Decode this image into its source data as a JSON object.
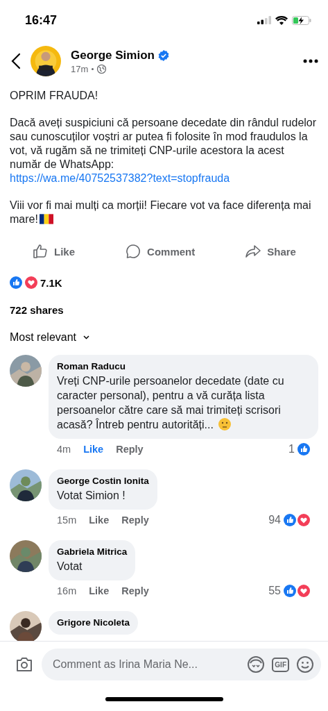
{
  "status_bar": {
    "time": "16:47"
  },
  "post": {
    "author": "George Simion",
    "verified": true,
    "time": "17m",
    "paragraphs": [
      {
        "text": "OPRIM FRAUDA!"
      },
      {
        "text": "Dacă aveți suspiciuni că persoane decedate din rândul rudelor sau cunoscuților voștri ar putea fi folosite în mod fraudulos la vot, vă rugăm să ne trimiteți CNP-urile acestora la acest număr de WhatsApp:",
        "link": "https://wa.me/40752537382?text=stopfrauda"
      },
      {
        "text": "Viii vor fi mai mulți ca morții! Fiecare vot va face diferența mai mare!",
        "flag": true
      }
    ]
  },
  "actions": [
    {
      "label": "Like",
      "kind": "like"
    },
    {
      "label": "Comment",
      "kind": "comment"
    },
    {
      "label": "Share",
      "kind": "share"
    }
  ],
  "reactions": {
    "types": [
      {
        "kind": "like"
      },
      {
        "kind": "love"
      }
    ],
    "count": "7.1K"
  },
  "shares": "722 shares",
  "sort": "Most relevant",
  "comments": [
    {
      "author": "Roman Raducu",
      "text": "Vreți CNP-urile persoanelor decedate (date cu caracter personal), pentru a vă curăța lista persoanelor către care să mai trimiteți scrisori acasă? Întreb pentru autorități...",
      "emoji": true,
      "time": "4m",
      "like": "Like",
      "liked": true,
      "reply": "Reply",
      "count": "1",
      "reactions": [
        {
          "kind": "like"
        }
      ]
    },
    {
      "author": "George Costin Ionita",
      "text": "Votat Simion !",
      "time": "15m",
      "like": "Like",
      "liked": false,
      "reply": "Reply",
      "count": "94",
      "reactions": [
        {
          "kind": "like"
        },
        {
          "kind": "love"
        }
      ]
    },
    {
      "author": "Gabriela Mitrica",
      "text": "Votat",
      "time": "16m",
      "like": "Like",
      "liked": false,
      "reply": "Reply",
      "count": "55",
      "reactions": [
        {
          "kind": "like"
        },
        {
          "kind": "love"
        }
      ]
    },
    {
      "author": "Grigore Nicoleta"
    }
  ],
  "composer": {
    "placeholder": "Comment as Irina Maria Ne...",
    "gif": "GIF"
  }
}
